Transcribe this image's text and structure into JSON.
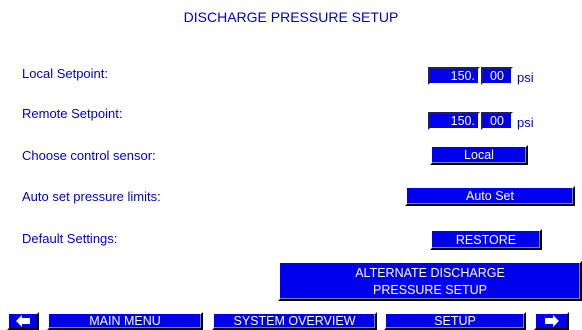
{
  "screen": {
    "title": "DISCHARGE PRESSURE SETUP"
  },
  "rows": {
    "local_setpoint": {
      "label": "Local Setpoint:",
      "whole": "150.",
      "decimal": "00",
      "unit": "psi"
    },
    "remote_setpoint": {
      "label": "Remote Setpoint:",
      "whole": "150.",
      "decimal": "00",
      "unit": "psi"
    },
    "control_sensor": {
      "label": "Choose control sensor:",
      "value": "Local"
    },
    "auto_limits": {
      "label": "Auto set pressure limits:",
      "button": "Auto Set"
    },
    "defaults": {
      "label": "Default Settings:",
      "button": "RESTORE"
    }
  },
  "alternate_button": {
    "line1": "ALTERNATE DISCHARGE",
    "line2": "PRESSURE SETUP"
  },
  "nav": {
    "main_menu": "MAIN MENU",
    "system_overview": "SYSTEM OVERVIEW",
    "setup": "SETUP",
    "prev_icon": "arrow-left-icon",
    "next_icon": "arrow-right-icon"
  },
  "colors": {
    "text": "#0000cc",
    "button": "#0000ee",
    "button_text": "#ffffff",
    "background": "#ffffff"
  }
}
